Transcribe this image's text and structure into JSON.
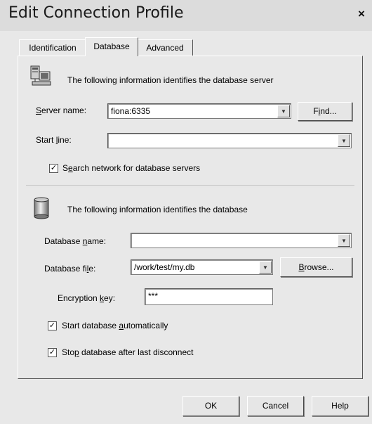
{
  "window": {
    "title": "Edit Connection Profile",
    "close_glyph": "×"
  },
  "tabs": [
    {
      "label": "Identification",
      "active": false
    },
    {
      "label": "Database",
      "active": true
    },
    {
      "label": "Advanced",
      "active": false
    }
  ],
  "server_section": {
    "icon": "server-computer-icon",
    "heading": "The following information identifies the database server",
    "server_name": {
      "label_pre": "",
      "label_u": "S",
      "label_post": "erver name:",
      "value": "fiona:6335"
    },
    "find_button": {
      "pre": "F",
      "u": "i",
      "post": "nd..."
    },
    "start_line": {
      "label_pre": "Start ",
      "label_u": "l",
      "label_post": "ine:",
      "value": ""
    },
    "search_network": {
      "checked": true,
      "pre": "S",
      "u": "e",
      "post": "arch network for database servers"
    }
  },
  "database_section": {
    "icon": "database-cylinder-icon",
    "heading": "The following information identifies the database",
    "database_name": {
      "label_pre": "Database ",
      "label_u": "n",
      "label_post": "ame:",
      "value": ""
    },
    "database_file": {
      "label_pre": "Database fi",
      "label_u": "l",
      "label_post": "e:",
      "value": "/work/test/my.db"
    },
    "browse_button": {
      "pre": "",
      "u": "B",
      "post": "rowse..."
    },
    "encryption_key": {
      "label_pre": "Encryption ",
      "label_u": "k",
      "label_post": "ey:",
      "value": "***"
    },
    "start_auto": {
      "checked": true,
      "pre": "Start database ",
      "u": "a",
      "post": "utomatically"
    },
    "stop_after": {
      "checked": true,
      "pre": "Sto",
      "u": "p",
      "post": " database after last disconnect"
    }
  },
  "footer": {
    "ok": "OK",
    "cancel": "Cancel",
    "help": "Help"
  }
}
